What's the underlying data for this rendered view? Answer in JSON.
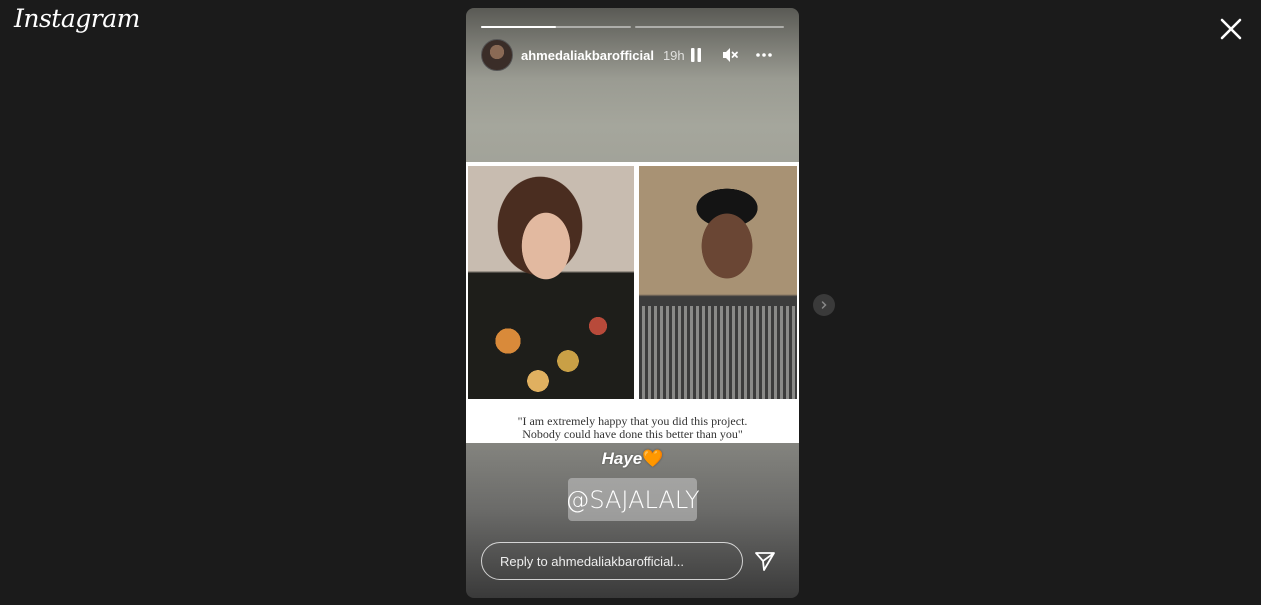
{
  "app": {
    "logo_text": "Instagram"
  },
  "story": {
    "progress": [
      0.5,
      0.0
    ],
    "username": "ahmedaliakbarofficial",
    "time": "19h",
    "quote_line1": "\"I am extremely happy that you did this project.",
    "quote_line2": "Nobody could have done this better than you\"",
    "caption": "Haye",
    "caption_emoji": "🧡",
    "mention": "@SAJALALY"
  },
  "reply": {
    "placeholder": "Reply to ahmedaliakbarofficial..."
  },
  "icons": {
    "close": "close-icon",
    "pause": "pause-icon",
    "mute": "mute-icon",
    "more": "more-icon",
    "send": "send-icon",
    "next": "chevron-right-icon"
  },
  "colors": {
    "background": "#1b1b1b",
    "text": "#ffffff"
  }
}
